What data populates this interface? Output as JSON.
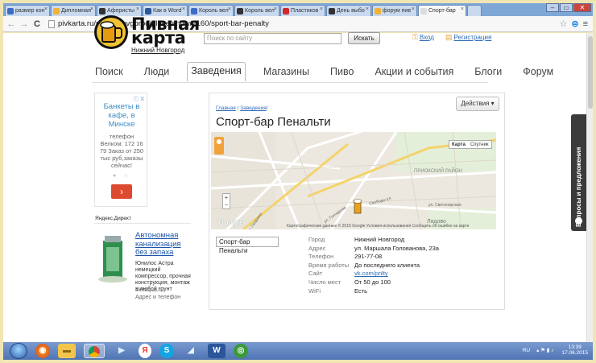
{
  "browser": {
    "tabs": [
      {
        "label": "размер кон",
        "color": "#3e6bc3"
      },
      {
        "label": "Дипломная",
        "color": "#f2b233"
      },
      {
        "label": "Аферисты",
        "color": "#333333"
      },
      {
        "label": "Как в Word",
        "color": "#2b579a"
      },
      {
        "label": "Король вел",
        "color": "#3e6bc3"
      },
      {
        "label": "Король вел",
        "color": "#333333"
      },
      {
        "label": "Пластиков",
        "color": "#d22a2a"
      },
      {
        "label": "День выбо",
        "color": "#333333"
      },
      {
        "label": "форум пив",
        "color": "#f2b233"
      },
      {
        "label": "Спорт-бар",
        "color": "#dddddd",
        "active": true
      }
    ],
    "url": "pivkarta.ru/nijniy_novgorod/place/show/2160/sport-bar-penalty"
  },
  "header": {
    "logo_line1": "Пивная",
    "logo_line2": "карта",
    "city": "Нижний Новгород",
    "search_placeholder": "Поиск по сайту",
    "search_button": "Искать",
    "login": "Вход",
    "register": "Регистрация"
  },
  "nav": {
    "items": [
      "Поиск",
      "Люди",
      "Заведения",
      "Магазины",
      "Пиво",
      "Акции и события",
      "Блоги",
      "Форум"
    ],
    "active": "Заведения"
  },
  "ad": {
    "badge": "ⓘ X",
    "title": "Банкеты в кафе, в Минске",
    "small": "телефон Велком: 172 16 79 Заказ от 250 тыс руб,заказы сейчас!"
  },
  "direct": {
    "label": "Яндекс.Директ",
    "title": "Автономная канализация без запаха",
    "desc": "Юнилос Астра немецкий компрессор, прочная конструкция, монтаж в любой грунт",
    "url": "sleraqua.ru",
    "addr": "Адрес и телефон"
  },
  "place": {
    "breadcrumb_home": "Главная",
    "breadcrumb_section": "Заведения",
    "actions": "Действия ▾",
    "title": "Спорт-бар Пенальти",
    "name_box": "Спорт-бар Пенальти"
  },
  "map": {
    "type_map": "Карта",
    "type_sat": "Спутник",
    "attribution": "Картографические данные © 2015 Google   Условия использования   Сообщить об ошибке на карте",
    "google": "Google",
    "labels": [
      "ПРИОКСКИЙ РАЙОН",
      "Свободы ул.",
      "ул. Гагарина",
      "ул. Гончарова",
      "ул. Светлоярская",
      "Лядово"
    ]
  },
  "info": {
    "rows": [
      {
        "k": "Город",
        "v": "Нижний Новгород"
      },
      {
        "k": "Адрес",
        "v": "ул. Маршала Голованова, 23а"
      },
      {
        "k": "Телефон",
        "v": "291-77-08"
      },
      {
        "k": "Время работы",
        "v": "До последнего клиента"
      },
      {
        "k": "Сайт",
        "v": "vk.com/pnlty"
      },
      {
        "k": "Число мест",
        "v": "От 50 до 100"
      },
      {
        "k": "WiFi",
        "v": "Есть"
      }
    ]
  },
  "feedback": "Вопросы и предложения",
  "taskbar": {
    "clock_time": "13:39",
    "clock_date": "17.06.2015",
    "tray": "RU"
  }
}
